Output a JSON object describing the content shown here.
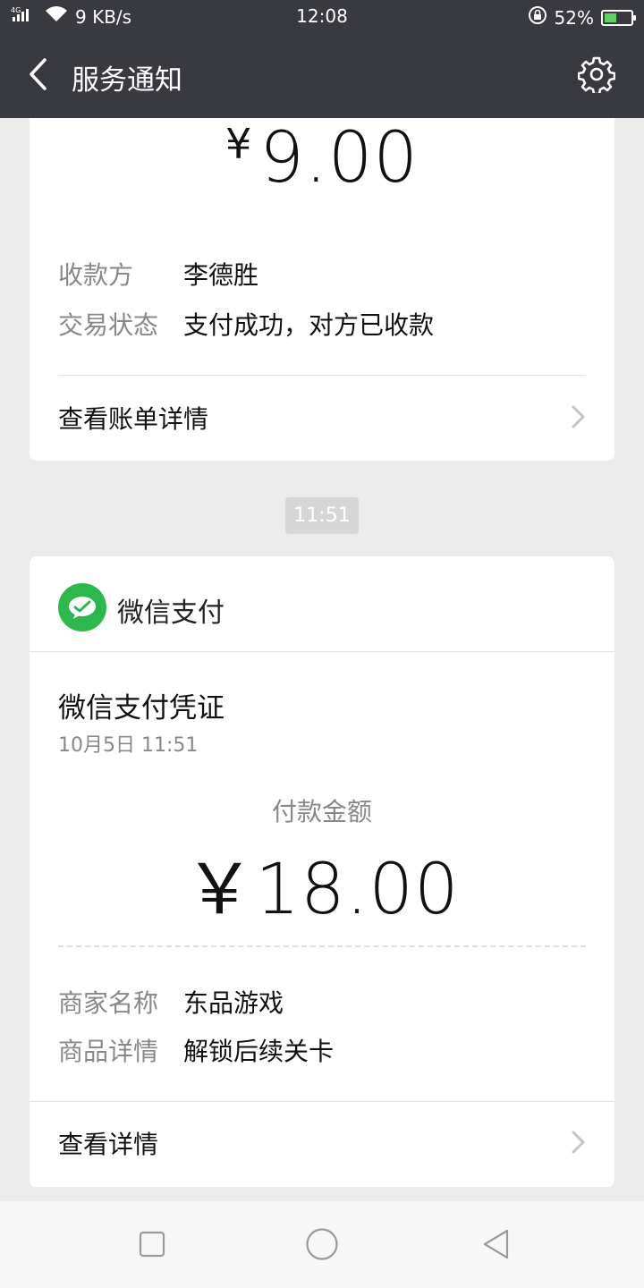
{
  "status_bar": {
    "network": "4G",
    "speed": "9 KB/s",
    "time": "12:08",
    "battery": "52%",
    "battery_level": 0.52
  },
  "header": {
    "title": "服务通知",
    "back_icon": "chevron-left-icon",
    "settings_icon": "gear-icon"
  },
  "notice1": {
    "currency": "¥",
    "amount": "9.00",
    "rows": [
      {
        "label": "收款方",
        "value": "李德胜"
      },
      {
        "label": "交易状态",
        "value": "支付成功，对方已收款"
      }
    ],
    "link_label": "查看账单详情"
  },
  "timestamp": "11:51",
  "notice2": {
    "brand_name": "微信支付",
    "title": "微信支付凭证",
    "date": "10月5日  11:51",
    "amount_label": "付款金额",
    "amount": "￥18.00",
    "rows": [
      {
        "label": "商家名称",
        "value": "东品游戏"
      },
      {
        "label": "商品详情",
        "value": "解锁后续关卡"
      }
    ],
    "link_label": "查看详情"
  },
  "colors": {
    "header_bg": "#393a3f",
    "page_bg": "#ebebeb",
    "wechat_green": "#2db84d"
  }
}
